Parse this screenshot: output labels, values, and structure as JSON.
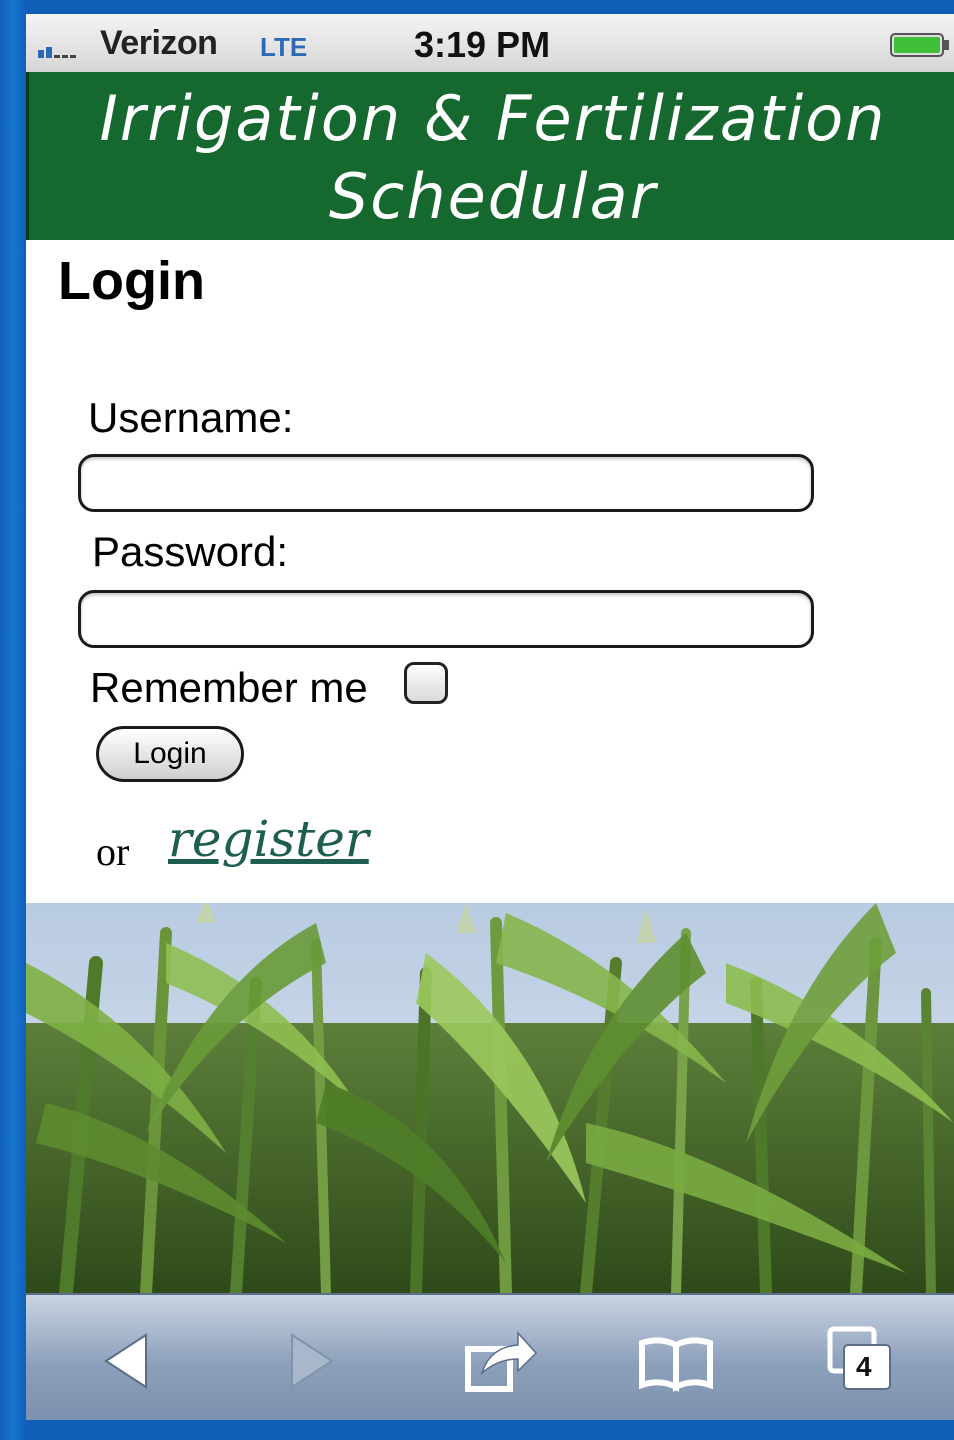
{
  "status_bar": {
    "carrier": "Verizon",
    "network": "LTE",
    "time": "3:19 PM",
    "battery_icon": "battery-full-icon",
    "signal_icon": "signal-bars-icon"
  },
  "header": {
    "title": "Irrigation & Fertilization Schedular",
    "background_color": "#15692f",
    "text_color": "#ffffff"
  },
  "login_form": {
    "title": "Login",
    "username_label": "Username:",
    "username_value": "",
    "password_label": "Password:",
    "password_value": "",
    "remember_label": "Remember me",
    "remember_checked": false,
    "login_button": "Login",
    "or_text": "or",
    "register_link": "register",
    "register_color": "#1e5e50"
  },
  "image": {
    "description_icon": "corn-field-photo"
  },
  "toolbar": {
    "items": [
      {
        "name": "back-button",
        "icon": "back-arrow-icon"
      },
      {
        "name": "forward-button",
        "icon": "forward-arrow-icon"
      },
      {
        "name": "share-button",
        "icon": "share-icon"
      },
      {
        "name": "bookmarks-button",
        "icon": "bookmarks-icon"
      },
      {
        "name": "tabs-button",
        "icon": "tabs-icon",
        "count": "4"
      }
    ]
  }
}
